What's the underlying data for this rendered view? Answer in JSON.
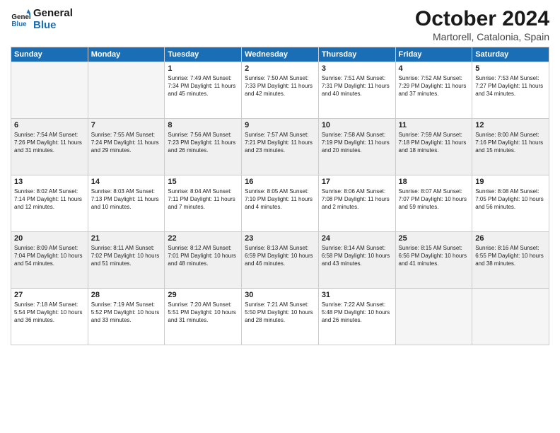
{
  "header": {
    "logo_line1": "General",
    "logo_line2": "Blue",
    "month_title": "October 2024",
    "location": "Martorell, Catalonia, Spain"
  },
  "weekdays": [
    "Sunday",
    "Monday",
    "Tuesday",
    "Wednesday",
    "Thursday",
    "Friday",
    "Saturday"
  ],
  "weeks": [
    [
      {
        "day": "",
        "info": ""
      },
      {
        "day": "",
        "info": ""
      },
      {
        "day": "1",
        "info": "Sunrise: 7:49 AM\nSunset: 7:34 PM\nDaylight: 11 hours and 45 minutes."
      },
      {
        "day": "2",
        "info": "Sunrise: 7:50 AM\nSunset: 7:33 PM\nDaylight: 11 hours and 42 minutes."
      },
      {
        "day": "3",
        "info": "Sunrise: 7:51 AM\nSunset: 7:31 PM\nDaylight: 11 hours and 40 minutes."
      },
      {
        "day": "4",
        "info": "Sunrise: 7:52 AM\nSunset: 7:29 PM\nDaylight: 11 hours and 37 minutes."
      },
      {
        "day": "5",
        "info": "Sunrise: 7:53 AM\nSunset: 7:27 PM\nDaylight: 11 hours and 34 minutes."
      }
    ],
    [
      {
        "day": "6",
        "info": "Sunrise: 7:54 AM\nSunset: 7:26 PM\nDaylight: 11 hours and 31 minutes."
      },
      {
        "day": "7",
        "info": "Sunrise: 7:55 AM\nSunset: 7:24 PM\nDaylight: 11 hours and 29 minutes."
      },
      {
        "day": "8",
        "info": "Sunrise: 7:56 AM\nSunset: 7:23 PM\nDaylight: 11 hours and 26 minutes."
      },
      {
        "day": "9",
        "info": "Sunrise: 7:57 AM\nSunset: 7:21 PM\nDaylight: 11 hours and 23 minutes."
      },
      {
        "day": "10",
        "info": "Sunrise: 7:58 AM\nSunset: 7:19 PM\nDaylight: 11 hours and 20 minutes."
      },
      {
        "day": "11",
        "info": "Sunrise: 7:59 AM\nSunset: 7:18 PM\nDaylight: 11 hours and 18 minutes."
      },
      {
        "day": "12",
        "info": "Sunrise: 8:00 AM\nSunset: 7:16 PM\nDaylight: 11 hours and 15 minutes."
      }
    ],
    [
      {
        "day": "13",
        "info": "Sunrise: 8:02 AM\nSunset: 7:14 PM\nDaylight: 11 hours and 12 minutes."
      },
      {
        "day": "14",
        "info": "Sunrise: 8:03 AM\nSunset: 7:13 PM\nDaylight: 11 hours and 10 minutes."
      },
      {
        "day": "15",
        "info": "Sunrise: 8:04 AM\nSunset: 7:11 PM\nDaylight: 11 hours and 7 minutes."
      },
      {
        "day": "16",
        "info": "Sunrise: 8:05 AM\nSunset: 7:10 PM\nDaylight: 11 hours and 4 minutes."
      },
      {
        "day": "17",
        "info": "Sunrise: 8:06 AM\nSunset: 7:08 PM\nDaylight: 11 hours and 2 minutes."
      },
      {
        "day": "18",
        "info": "Sunrise: 8:07 AM\nSunset: 7:07 PM\nDaylight: 10 hours and 59 minutes."
      },
      {
        "day": "19",
        "info": "Sunrise: 8:08 AM\nSunset: 7:05 PM\nDaylight: 10 hours and 56 minutes."
      }
    ],
    [
      {
        "day": "20",
        "info": "Sunrise: 8:09 AM\nSunset: 7:04 PM\nDaylight: 10 hours and 54 minutes."
      },
      {
        "day": "21",
        "info": "Sunrise: 8:11 AM\nSunset: 7:02 PM\nDaylight: 10 hours and 51 minutes."
      },
      {
        "day": "22",
        "info": "Sunrise: 8:12 AM\nSunset: 7:01 PM\nDaylight: 10 hours and 48 minutes."
      },
      {
        "day": "23",
        "info": "Sunrise: 8:13 AM\nSunset: 6:59 PM\nDaylight: 10 hours and 46 minutes."
      },
      {
        "day": "24",
        "info": "Sunrise: 8:14 AM\nSunset: 6:58 PM\nDaylight: 10 hours and 43 minutes."
      },
      {
        "day": "25",
        "info": "Sunrise: 8:15 AM\nSunset: 6:56 PM\nDaylight: 10 hours and 41 minutes."
      },
      {
        "day": "26",
        "info": "Sunrise: 8:16 AM\nSunset: 6:55 PM\nDaylight: 10 hours and 38 minutes."
      }
    ],
    [
      {
        "day": "27",
        "info": "Sunrise: 7:18 AM\nSunset: 5:54 PM\nDaylight: 10 hours and 36 minutes."
      },
      {
        "day": "28",
        "info": "Sunrise: 7:19 AM\nSunset: 5:52 PM\nDaylight: 10 hours and 33 minutes."
      },
      {
        "day": "29",
        "info": "Sunrise: 7:20 AM\nSunset: 5:51 PM\nDaylight: 10 hours and 31 minutes."
      },
      {
        "day": "30",
        "info": "Sunrise: 7:21 AM\nSunset: 5:50 PM\nDaylight: 10 hours and 28 minutes."
      },
      {
        "day": "31",
        "info": "Sunrise: 7:22 AM\nSunset: 5:48 PM\nDaylight: 10 hours and 26 minutes."
      },
      {
        "day": "",
        "info": ""
      },
      {
        "day": "",
        "info": ""
      }
    ]
  ]
}
